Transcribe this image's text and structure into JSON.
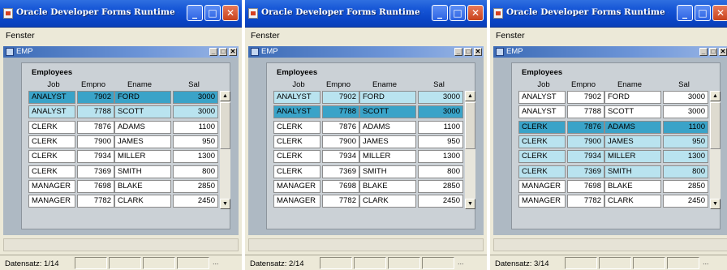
{
  "windows": [
    {
      "title": "Oracle Developer Forms Runtime - Web",
      "menu": "Fenster",
      "form_title": "EMP",
      "group_title": "Employees",
      "columns": [
        "Job",
        "Empno",
        "Ename",
        "Sal"
      ],
      "rows": [
        {
          "job": "ANALYST",
          "empno": "7902",
          "ename": "FORD",
          "sal": "3000",
          "state": "current"
        },
        {
          "job": "ANALYST",
          "empno": "7788",
          "ename": "SCOTT",
          "sal": "3000",
          "state": "selected"
        },
        {
          "job": "CLERK",
          "empno": "7876",
          "ename": "ADAMS",
          "sal": "1100",
          "state": "normal"
        },
        {
          "job": "CLERK",
          "empno": "7900",
          "ename": "JAMES",
          "sal": "950",
          "state": "normal"
        },
        {
          "job": "CLERK",
          "empno": "7934",
          "ename": "MILLER",
          "sal": "1300",
          "state": "normal"
        },
        {
          "job": "CLERK",
          "empno": "7369",
          "ename": "SMITH",
          "sal": "800",
          "state": "normal"
        },
        {
          "job": "MANAGER",
          "empno": "7698",
          "ename": "BLAKE",
          "sal": "2850",
          "state": "normal"
        },
        {
          "job": "MANAGER",
          "empno": "7782",
          "ename": "CLARK",
          "sal": "2450",
          "state": "normal"
        }
      ],
      "status": "Datensatz: 1/14",
      "status_dots": "..."
    },
    {
      "title": "Oracle Developer Forms Runtime - Web",
      "menu": "Fenster",
      "form_title": "EMP",
      "group_title": "Employees",
      "columns": [
        "Job",
        "Empno",
        "Ename",
        "Sal"
      ],
      "rows": [
        {
          "job": "ANALYST",
          "empno": "7902",
          "ename": "FORD",
          "sal": "3000",
          "state": "selected"
        },
        {
          "job": "ANALYST",
          "empno": "7788",
          "ename": "SCOTT",
          "sal": "3000",
          "state": "current"
        },
        {
          "job": "CLERK",
          "empno": "7876",
          "ename": "ADAMS",
          "sal": "1100",
          "state": "normal"
        },
        {
          "job": "CLERK",
          "empno": "7900",
          "ename": "JAMES",
          "sal": "950",
          "state": "normal"
        },
        {
          "job": "CLERK",
          "empno": "7934",
          "ename": "MILLER",
          "sal": "1300",
          "state": "normal"
        },
        {
          "job": "CLERK",
          "empno": "7369",
          "ename": "SMITH",
          "sal": "800",
          "state": "normal"
        },
        {
          "job": "MANAGER",
          "empno": "7698",
          "ename": "BLAKE",
          "sal": "2850",
          "state": "normal"
        },
        {
          "job": "MANAGER",
          "empno": "7782",
          "ename": "CLARK",
          "sal": "2450",
          "state": "normal"
        }
      ],
      "status": "Datensatz: 2/14",
      "status_dots": "..."
    },
    {
      "title": "Oracle Developer Forms Runtime - Web",
      "menu": "Fenster",
      "form_title": "EMP",
      "group_title": "Employees",
      "columns": [
        "Job",
        "Empno",
        "Ename",
        "Sal"
      ],
      "rows": [
        {
          "job": "ANALYST",
          "empno": "7902",
          "ename": "FORD",
          "sal": "3000",
          "state": "normal"
        },
        {
          "job": "ANALYST",
          "empno": "7788",
          "ename": "SCOTT",
          "sal": "3000",
          "state": "normal"
        },
        {
          "job": "CLERK",
          "empno": "7876",
          "ename": "ADAMS",
          "sal": "1100",
          "state": "current"
        },
        {
          "job": "CLERK",
          "empno": "7900",
          "ename": "JAMES",
          "sal": "950",
          "state": "selected"
        },
        {
          "job": "CLERK",
          "empno": "7934",
          "ename": "MILLER",
          "sal": "1300",
          "state": "selected"
        },
        {
          "job": "CLERK",
          "empno": "7369",
          "ename": "SMITH",
          "sal": "800",
          "state": "selected"
        },
        {
          "job": "MANAGER",
          "empno": "7698",
          "ename": "BLAKE",
          "sal": "2850",
          "state": "normal"
        },
        {
          "job": "MANAGER",
          "empno": "7782",
          "ename": "CLARK",
          "sal": "2450",
          "state": "normal"
        }
      ],
      "status": "Datensatz: 3/14",
      "status_dots": "..."
    }
  ],
  "icons": {
    "minimize": "_",
    "maximize": "□",
    "close": "✕",
    "scroll_up": "▲",
    "scroll_down": "▼"
  }
}
